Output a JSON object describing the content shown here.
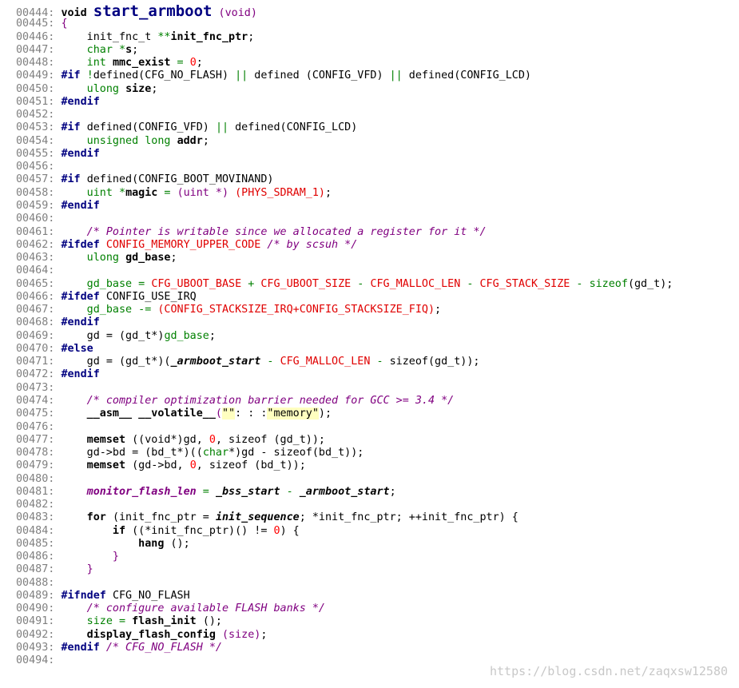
{
  "colors": {
    "background": "#ffffff",
    "line_number": "#808080",
    "preprocessor": "#000080",
    "type": "#008000",
    "macro": "#e00000",
    "comment": "#800080",
    "string_bg": "#ffffc0",
    "watermark": "#c8c8c8"
  },
  "watermark": "https://blog.csdn.net/zaqxsw12580",
  "lines": [
    {
      "n": "00444:",
      "tokens": [
        [
          "kw",
          "void "
        ],
        [
          "big",
          "start_armboot"
        ],
        [
          "pun",
          " (void)"
        ]
      ]
    },
    {
      "n": "00445:",
      "tokens": [
        [
          "pun",
          "{"
        ]
      ]
    },
    {
      "n": "00446:",
      "tokens": [
        [
          "n",
          "    init_fnc_t "
        ],
        [
          "op",
          "**"
        ],
        [
          "fn",
          "init_fnc_ptr"
        ],
        [
          "n",
          ";"
        ]
      ]
    },
    {
      "n": "00447:",
      "tokens": [
        [
          "ty",
          "    char "
        ],
        [
          "op",
          "*"
        ],
        [
          "fn",
          "s"
        ],
        [
          "n",
          ";"
        ]
      ]
    },
    {
      "n": "00448:",
      "tokens": [
        [
          "ty",
          "    int "
        ],
        [
          "fn",
          "mmc_exist"
        ],
        [
          "op",
          " = "
        ],
        [
          "num",
          "0"
        ],
        [
          "n",
          ";"
        ]
      ]
    },
    {
      "n": "00449:",
      "tokens": [
        [
          "pp",
          "#if "
        ],
        [
          "op",
          "!"
        ],
        [
          "n",
          "defined(CFG_NO_FLASH) "
        ],
        [
          "op",
          "||"
        ],
        [
          "n",
          " defined (CONFIG_VFD) "
        ],
        [
          "op",
          "||"
        ],
        [
          "n",
          " defined(CONFIG_LCD)"
        ]
      ]
    },
    {
      "n": "00450:",
      "tokens": [
        [
          "ty",
          "    ulong "
        ],
        [
          "fn",
          "size"
        ],
        [
          "n",
          ";"
        ]
      ]
    },
    {
      "n": "00451:",
      "tokens": [
        [
          "pp",
          "#endif"
        ]
      ]
    },
    {
      "n": "00452:",
      "tokens": []
    },
    {
      "n": "00453:",
      "tokens": [
        [
          "pp",
          "#if "
        ],
        [
          "n",
          "defined(CONFIG_VFD) "
        ],
        [
          "op",
          "||"
        ],
        [
          "n",
          " defined(CONFIG_LCD)"
        ]
      ]
    },
    {
      "n": "00454:",
      "tokens": [
        [
          "ty",
          "    unsigned long "
        ],
        [
          "fn",
          "addr"
        ],
        [
          "n",
          ";"
        ]
      ]
    },
    {
      "n": "00455:",
      "tokens": [
        [
          "pp",
          "#endif"
        ]
      ]
    },
    {
      "n": "00456:",
      "tokens": []
    },
    {
      "n": "00457:",
      "tokens": [
        [
          "pp",
          "#if "
        ],
        [
          "n",
          "defined(CONFIG_BOOT_MOVINAND)"
        ]
      ]
    },
    {
      "n": "00458:",
      "tokens": [
        [
          "ty",
          "    uint "
        ],
        [
          "op",
          "*"
        ],
        [
          "fn",
          "magic"
        ],
        [
          "op",
          " = "
        ],
        [
          "pun",
          "(uint *) "
        ],
        [
          "mac",
          "(PHYS_SDRAM_1)"
        ],
        [
          "n",
          ";"
        ]
      ]
    },
    {
      "n": "00459:",
      "tokens": [
        [
          "pp",
          "#endif"
        ]
      ]
    },
    {
      "n": "00460:",
      "tokens": []
    },
    {
      "n": "00461:",
      "tokens": [
        [
          "cm",
          "    /* Pointer is writable since we allocated a register for it */"
        ]
      ]
    },
    {
      "n": "00462:",
      "tokens": [
        [
          "pp",
          "#ifdef "
        ],
        [
          "mac",
          "CONFIG_MEMORY_UPPER_CODE"
        ],
        [
          "cm",
          " /* by scsuh */"
        ]
      ]
    },
    {
      "n": "00463:",
      "tokens": [
        [
          "ty",
          "    ulong "
        ],
        [
          "fn",
          "gd_base"
        ],
        [
          "n",
          ";"
        ]
      ]
    },
    {
      "n": "00464:",
      "tokens": []
    },
    {
      "n": "00465:",
      "tokens": [
        [
          "ty",
          "    gd_base"
        ],
        [
          "op",
          " = "
        ],
        [
          "mac",
          "CFG_UBOOT_BASE"
        ],
        [
          "op",
          " + "
        ],
        [
          "mac",
          "CFG_UBOOT_SIZE"
        ],
        [
          "op",
          " - "
        ],
        [
          "mac",
          "CFG_MALLOC_LEN"
        ],
        [
          "op",
          " - "
        ],
        [
          "mac",
          "CFG_STACK_SIZE"
        ],
        [
          "op",
          " - "
        ],
        [
          "ty",
          "sizeof"
        ],
        [
          "n",
          "(gd_t);"
        ]
      ]
    },
    {
      "n": "00466:",
      "tokens": [
        [
          "pp",
          "#ifdef "
        ],
        [
          "n",
          "CONFIG_USE_IRQ"
        ]
      ]
    },
    {
      "n": "00467:",
      "tokens": [
        [
          "ty",
          "    gd_base"
        ],
        [
          "op",
          " -= "
        ],
        [
          "mac",
          "(CONFIG_STACKSIZE_IRQ+CONFIG_STACKSIZE_FIQ)"
        ],
        [
          "n",
          ";"
        ]
      ]
    },
    {
      "n": "00468:",
      "tokens": [
        [
          "pp",
          "#endif"
        ]
      ]
    },
    {
      "n": "00469:",
      "tokens": [
        [
          "n",
          "    gd = (gd_t*)"
        ],
        [
          "ty",
          "gd_base"
        ],
        [
          "n",
          ";"
        ]
      ]
    },
    {
      "n": "00470:",
      "tokens": [
        [
          "pp",
          "#else"
        ]
      ]
    },
    {
      "n": "00471:",
      "tokens": [
        [
          "n",
          "    gd = (gd_t*)("
        ],
        [
          "ital",
          "_armboot_start"
        ],
        [
          "op",
          " - "
        ],
        [
          "mac",
          "CFG_MALLOC_LEN"
        ],
        [
          "op",
          " - "
        ],
        [
          "n",
          "sizeof(gd_t));"
        ]
      ]
    },
    {
      "n": "00472:",
      "tokens": [
        [
          "pp",
          "#endif"
        ]
      ]
    },
    {
      "n": "00473:",
      "tokens": []
    },
    {
      "n": "00474:",
      "tokens": [
        [
          "cm",
          "    /* compiler optimization barrier needed for GCC >= 3.4 */"
        ]
      ]
    },
    {
      "n": "00475:",
      "tokens": [
        [
          "fn",
          "    __asm__ __volatile__"
        ],
        [
          "pun",
          "("
        ],
        [
          "str",
          "\"\""
        ],
        [
          "n",
          ": : :"
        ],
        [
          "str",
          "\"memory\""
        ],
        [
          "n",
          ");"
        ]
      ]
    },
    {
      "n": "00476:",
      "tokens": []
    },
    {
      "n": "00477:",
      "tokens": [
        [
          "fn",
          "    memset "
        ],
        [
          "n",
          "((void*)gd, "
        ],
        [
          "num",
          "0"
        ],
        [
          "n",
          ", sizeof (gd_t));"
        ]
      ]
    },
    {
      "n": "00478:",
      "tokens": [
        [
          "n",
          "    gd->bd = (bd_t*)(("
        ],
        [
          "ty",
          "char"
        ],
        [
          "n",
          "*)gd - sizeof(bd_t));"
        ]
      ]
    },
    {
      "n": "00479:",
      "tokens": [
        [
          "fn",
          "    memset "
        ],
        [
          "n",
          "(gd->bd, "
        ],
        [
          "num",
          "0"
        ],
        [
          "n",
          ", sizeof (bd_t));"
        ]
      ]
    },
    {
      "n": "00480:",
      "tokens": []
    },
    {
      "n": "00481:",
      "tokens": [
        [
          "it",
          "    monitor_flash_len"
        ],
        [
          "op",
          " = "
        ],
        [
          "ital",
          "_bss_start"
        ],
        [
          "op",
          " - "
        ],
        [
          "ital",
          "_armboot_start"
        ],
        [
          "n",
          ";"
        ]
      ]
    },
    {
      "n": "00482:",
      "tokens": []
    },
    {
      "n": "00483:",
      "tokens": [
        [
          "fn",
          "    for "
        ],
        [
          "n",
          "(init_fnc_ptr = "
        ],
        [
          "ital",
          "init_sequence"
        ],
        [
          "n",
          "; *init_fnc_ptr; ++init_fnc_ptr) {"
        ]
      ]
    },
    {
      "n": "00484:",
      "tokens": [
        [
          "fn",
          "        if "
        ],
        [
          "n",
          "((*init_fnc_ptr)() != "
        ],
        [
          "num",
          "0"
        ],
        [
          "n",
          ") {"
        ]
      ]
    },
    {
      "n": "00485:",
      "tokens": [
        [
          "fn",
          "            hang "
        ],
        [
          "n",
          "();"
        ]
      ]
    },
    {
      "n": "00486:",
      "tokens": [
        [
          "pun",
          "        }"
        ]
      ]
    },
    {
      "n": "00487:",
      "tokens": [
        [
          "pun",
          "    }"
        ]
      ]
    },
    {
      "n": "00488:",
      "tokens": []
    },
    {
      "n": "00489:",
      "tokens": [
        [
          "pp",
          "#ifndef "
        ],
        [
          "n",
          "CFG_NO_FLASH"
        ]
      ]
    },
    {
      "n": "00490:",
      "tokens": [
        [
          "cm",
          "    /* configure available FLASH banks */"
        ]
      ]
    },
    {
      "n": "00491:",
      "tokens": [
        [
          "ty",
          "    size"
        ],
        [
          "op",
          " = "
        ],
        [
          "fn",
          "flash_init "
        ],
        [
          "n",
          "();"
        ]
      ]
    },
    {
      "n": "00492:",
      "tokens": [
        [
          "fn",
          "    display_flash_config "
        ],
        [
          "pun",
          "(size)"
        ],
        [
          "n",
          ";"
        ]
      ]
    },
    {
      "n": "00493:",
      "tokens": [
        [
          "pp",
          "#endif "
        ],
        [
          "cm",
          "/* CFG_NO_FLASH */"
        ]
      ]
    },
    {
      "n": "00494:",
      "tokens": []
    }
  ]
}
